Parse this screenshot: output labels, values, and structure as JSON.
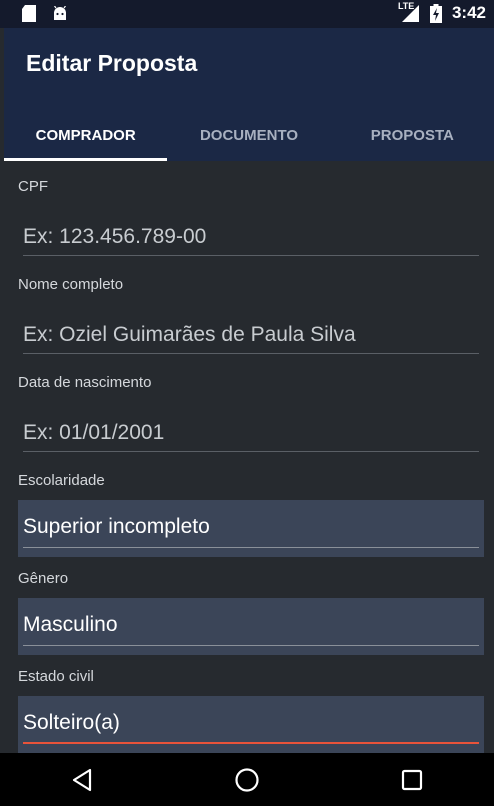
{
  "status_bar": {
    "left_icons": [
      "sd-card-icon",
      "android-icon"
    ],
    "network": "LTE",
    "time": "3:42"
  },
  "app_bar": {
    "title": "Editar Proposta",
    "tabs": [
      {
        "label": "COMPRADOR",
        "active": true
      },
      {
        "label": "DOCUMENTO",
        "active": false
      },
      {
        "label": "PROPOSTA",
        "active": false
      }
    ]
  },
  "form": {
    "cpf": {
      "label": "CPF",
      "placeholder": "Ex: 123.456.789-00"
    },
    "nome": {
      "label": "Nome completo",
      "placeholder": "Ex: Oziel Guimarães de Paula Silva"
    },
    "nascimento": {
      "label": "Data de nascimento",
      "placeholder": "Ex: 01/01/2001"
    },
    "escolaridade": {
      "label": "Escolaridade",
      "value": "Superior incompleto"
    },
    "genero": {
      "label": "Gênero",
      "value": "Masculino"
    },
    "estado_civil": {
      "label": "Estado civil",
      "value": "Solteiro(a)"
    }
  },
  "nav_bar": {
    "buttons": [
      "back-icon",
      "home-icon",
      "recents-icon"
    ]
  },
  "colors": {
    "app_bar": "#1b2845",
    "background": "#262a2f",
    "spinner_bg": "#3b4558",
    "accent": "#e8533a"
  }
}
